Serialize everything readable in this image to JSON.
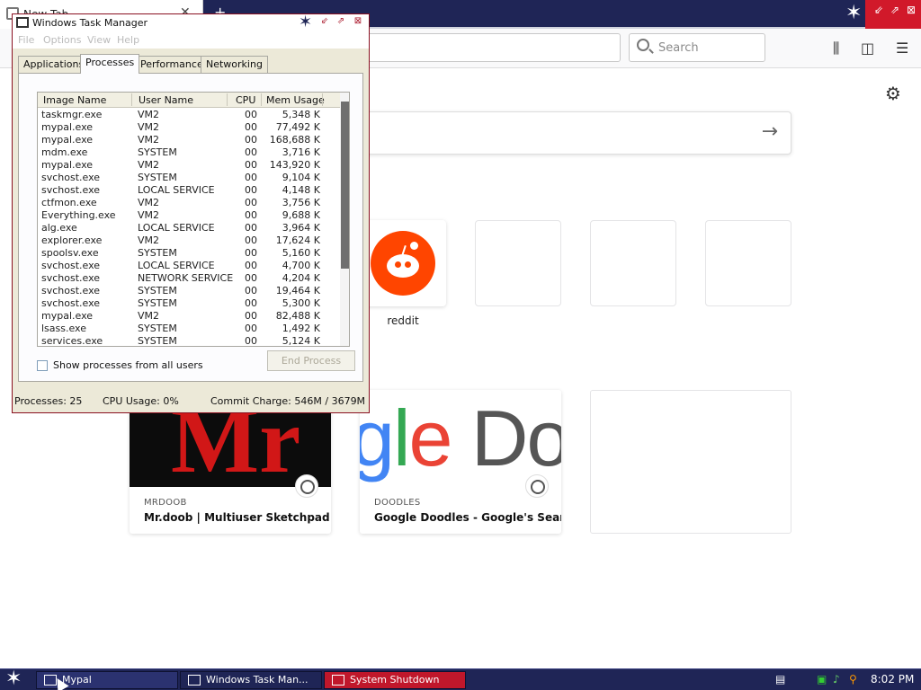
{
  "browser": {
    "tab_title": "New Tab",
    "tab_close": "✕",
    "newtab_plus": "+",
    "search_placeholder": "Search",
    "settings_icon": "gear-icon",
    "home_search_arrow": "→",
    "top_sites": [
      {
        "label": "reddit"
      }
    ],
    "highlights": [
      {
        "source": "MRDOOB",
        "title": "Mr.doob | Multiuser Sketchpad",
        "thumb_text": "Mr"
      },
      {
        "source": "DOODLES",
        "title": "Google Doodles - Google's Searc...",
        "thumb_text": "gle Doo"
      }
    ]
  },
  "taskmgr": {
    "title": "Windows Task Manager",
    "menu": [
      "File",
      "Options",
      "View",
      "Help"
    ],
    "tabs": [
      "Applications",
      "Processes",
      "Performance",
      "Networking"
    ],
    "active_tab": "Processes",
    "columns": [
      "Image Name",
      "User Name",
      "CPU",
      "Mem Usage"
    ],
    "processes": [
      {
        "name": "taskmgr.exe",
        "user": "VM2",
        "cpu": "00",
        "mem": "5,348 K"
      },
      {
        "name": "mypal.exe",
        "user": "VM2",
        "cpu": "00",
        "mem": "77,492 K"
      },
      {
        "name": "mypal.exe",
        "user": "VM2",
        "cpu": "00",
        "mem": "168,688 K"
      },
      {
        "name": "mdm.exe",
        "user": "SYSTEM",
        "cpu": "00",
        "mem": "3,716 K"
      },
      {
        "name": "mypal.exe",
        "user": "VM2",
        "cpu": "00",
        "mem": "143,920 K"
      },
      {
        "name": "svchost.exe",
        "user": "SYSTEM",
        "cpu": "00",
        "mem": "9,104 K"
      },
      {
        "name": "svchost.exe",
        "user": "LOCAL SERVICE",
        "cpu": "00",
        "mem": "4,148 K"
      },
      {
        "name": "ctfmon.exe",
        "user": "VM2",
        "cpu": "00",
        "mem": "3,756 K"
      },
      {
        "name": "Everything.exe",
        "user": "VM2",
        "cpu": "00",
        "mem": "9,688 K"
      },
      {
        "name": "alg.exe",
        "user": "LOCAL SERVICE",
        "cpu": "00",
        "mem": "3,964 K"
      },
      {
        "name": "explorer.exe",
        "user": "VM2",
        "cpu": "00",
        "mem": "17,624 K"
      },
      {
        "name": "spoolsv.exe",
        "user": "SYSTEM",
        "cpu": "00",
        "mem": "5,160 K"
      },
      {
        "name": "svchost.exe",
        "user": "LOCAL SERVICE",
        "cpu": "00",
        "mem": "4,700 K"
      },
      {
        "name": "svchost.exe",
        "user": "NETWORK SERVICE",
        "cpu": "00",
        "mem": "4,204 K"
      },
      {
        "name": "svchost.exe",
        "user": "SYSTEM",
        "cpu": "00",
        "mem": "19,464 K"
      },
      {
        "name": "svchost.exe",
        "user": "SYSTEM",
        "cpu": "00",
        "mem": "5,300 K"
      },
      {
        "name": "mypal.exe",
        "user": "VM2",
        "cpu": "00",
        "mem": "82,488 K"
      },
      {
        "name": "lsass.exe",
        "user": "SYSTEM",
        "cpu": "00",
        "mem": "1,492 K"
      },
      {
        "name": "services.exe",
        "user": "SYSTEM",
        "cpu": "00",
        "mem": "5,124 K"
      }
    ],
    "show_all_label": "Show processes from all users",
    "end_process_label": "End Process",
    "status": {
      "processes": "Processes: 25",
      "cpu": "CPU Usage: 0%",
      "commit": "Commit Charge: 546M / 3679M"
    }
  },
  "taskbar": {
    "buttons": [
      {
        "label": "Mypal"
      },
      {
        "label": "Windows Task Man..."
      },
      {
        "label": "System Shutdown"
      }
    ],
    "clock": "8:02 PM"
  },
  "colors": {
    "taskbar_bg": "#1f2556",
    "taskmgr_border": "#8a1020",
    "shutdown_btn": "#c0172b",
    "reddit": "#ff4500"
  }
}
